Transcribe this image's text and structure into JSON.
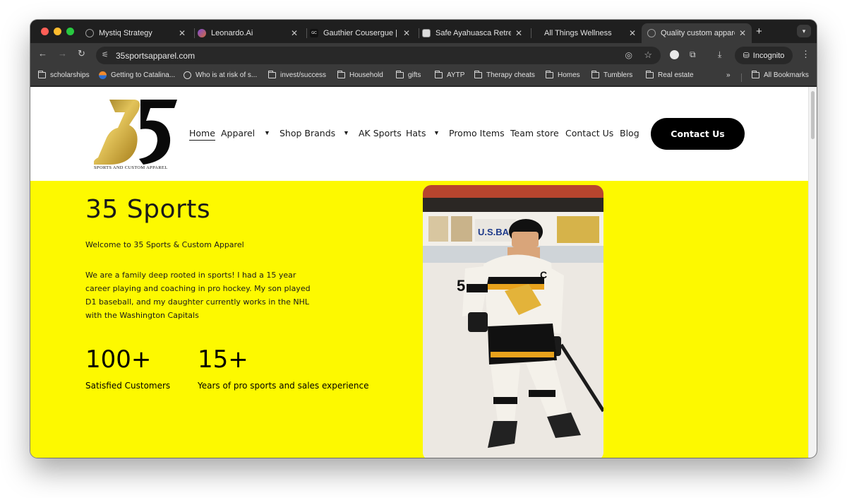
{
  "browser": {
    "tabs": [
      {
        "title": "Mystiq Strategy",
        "favicon": "globe-icon",
        "active": false
      },
      {
        "title": "Leonardo.Ai",
        "favicon": "leonardo-icon",
        "active": false
      },
      {
        "title": "Gauthier Cousergue | B",
        "favicon": "gc-icon",
        "active": false
      },
      {
        "title": "Safe Ayahuasca Retreat",
        "favicon": "retreat-icon",
        "active": false
      },
      {
        "title": "All Things Wellness",
        "favicon": "",
        "active": false
      },
      {
        "title": "Quality custom apparel",
        "favicon": "globe-icon",
        "active": true
      }
    ],
    "new_tab": "+",
    "url": "35sportsapparel.com",
    "incognito_label": "Incognito",
    "bookmarks": [
      {
        "label": "scholarships",
        "icon": "folder-icon"
      },
      {
        "label": "Getting to Catalina...",
        "icon": "site-icon"
      },
      {
        "label": "Who is at risk of s...",
        "icon": "globe-icon"
      },
      {
        "label": "invest/success",
        "icon": "folder-icon"
      },
      {
        "label": "Household",
        "icon": "folder-icon"
      },
      {
        "label": "gifts",
        "icon": "folder-icon"
      },
      {
        "label": "AYTP",
        "icon": "folder-icon"
      },
      {
        "label": "Therapy cheats",
        "icon": "folder-icon"
      },
      {
        "label": "Homes",
        "icon": "folder-icon"
      },
      {
        "label": "Tumblers",
        "icon": "folder-icon"
      },
      {
        "label": "Real estate",
        "icon": "folder-icon"
      }
    ],
    "bookmarks_overflow": "»",
    "all_bookmarks": "All Bookmarks"
  },
  "site": {
    "logo_text": "35",
    "logo_tagline": "SPORTS AND CUSTOM APPAREL",
    "nav": {
      "home": "Home",
      "apparel": "Apparel",
      "shop_brands": "Shop Brands",
      "ak_sports": "AK Sports",
      "hats": "Hats",
      "promo_items": "Promo Items",
      "team_store": "Team store",
      "contact_us": "Contact Us",
      "blog": "Blog"
    },
    "cta_label": "Contact Us"
  },
  "hero": {
    "title": "35 Sports",
    "welcome": "Welcome to 35 Sports & Custom Apparel",
    "body": "We are a family deep rooted in sports! I had a 15 year career playing and coaching in pro hockey. My son played D1 baseball, and my daughter currently works in the NHL with the Washington Capitals",
    "stats": [
      {
        "value": "100+",
        "label": "Satisfied Customers"
      },
      {
        "value": "15+",
        "label": "Years of pro sports and sales experience"
      }
    ],
    "photo": {
      "description_icon": "hockey-player-photo",
      "jersey_number": "5",
      "jersey_letter": "C",
      "rink_sign": "U.S.BA"
    }
  },
  "colors": {
    "hero_bg": "#fdf900",
    "cta_bg": "#000000",
    "logo_gold": "#c9a227",
    "browser_frame": "#1f1f1f",
    "browser_toolbar": "#3a3a3a"
  }
}
